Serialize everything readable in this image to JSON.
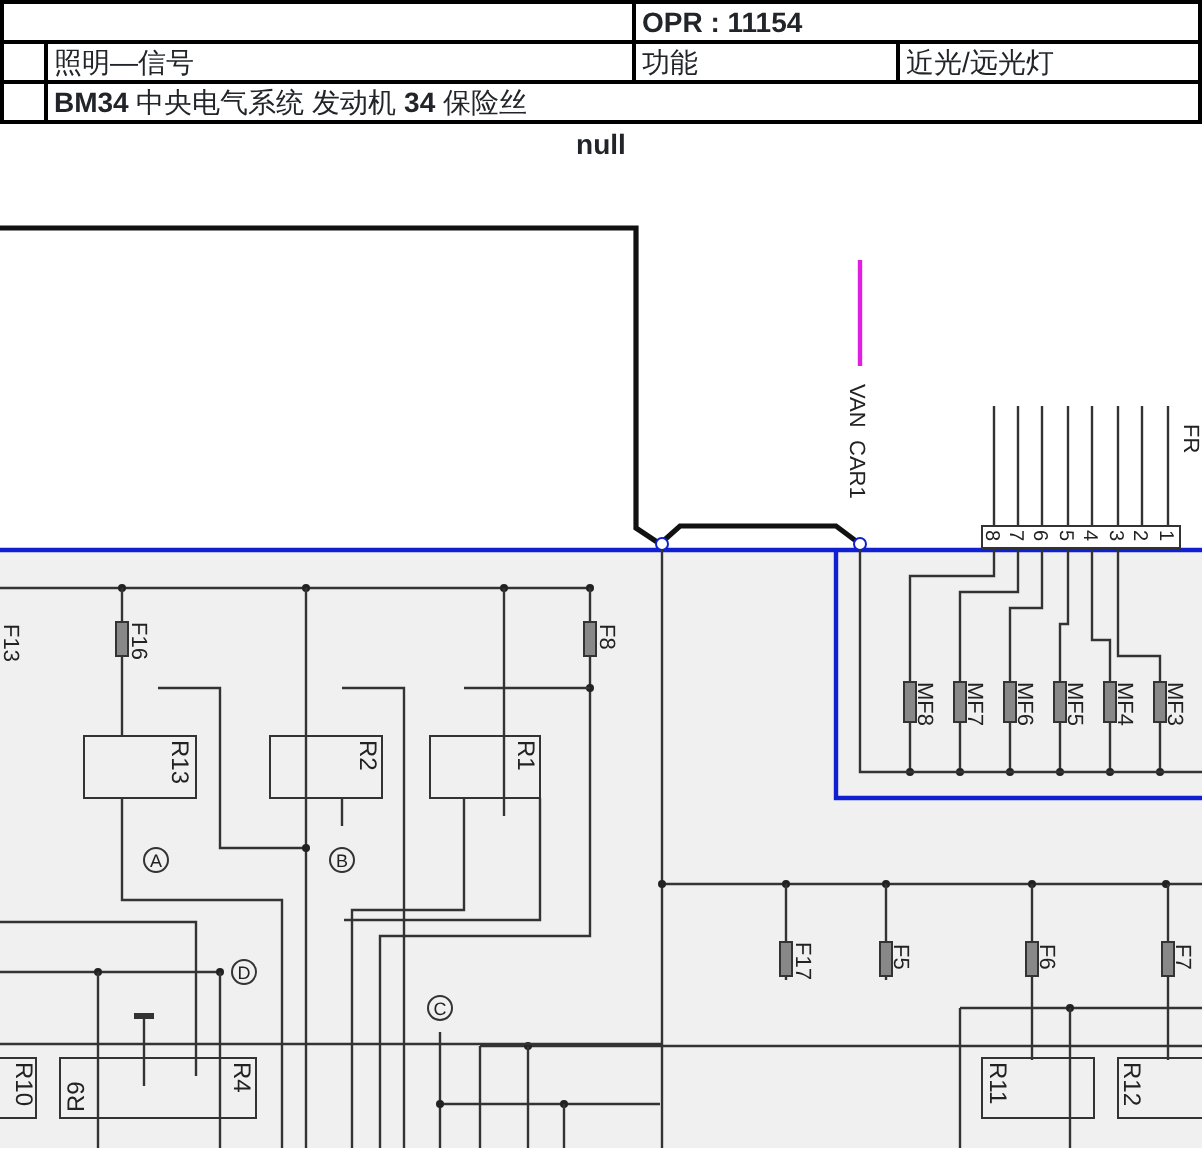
{
  "header": {
    "opr": "OPR : 11154",
    "system": "照明—信号",
    "function_label": "功能",
    "function": "近光/远光灯",
    "component": "**BM34** 中央电气系统  发动机  **34** 保险丝"
  },
  "diagram": {
    "title": "null",
    "signal_labels": [
      "VAN",
      "CAR1"
    ],
    "connector_pins": [
      "8",
      "7",
      "6",
      "5",
      "4",
      "3",
      "2",
      "1"
    ],
    "edge_labels": [
      "FR"
    ],
    "fuses": [
      "MF8",
      "MF7",
      "MF6",
      "MF5",
      "MF4",
      "MF3",
      "F13",
      "F16",
      "F8",
      "F17",
      "F5",
      "F6",
      "F7"
    ],
    "relays": [
      "R13",
      "R2",
      "R1",
      "R10",
      "R9",
      "R4",
      "R11",
      "R12"
    ],
    "markers": [
      "A",
      "B",
      "D",
      "C"
    ]
  }
}
